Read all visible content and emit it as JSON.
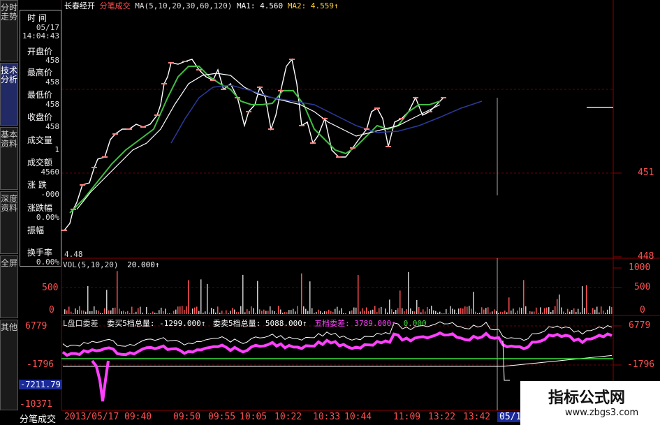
{
  "tabs": [
    {
      "label": "分时走势"
    },
    {
      "label": "技术分析"
    },
    {
      "label": "基本资料"
    },
    {
      "label": "深度资料"
    },
    {
      "label": "全屏"
    },
    {
      "label": "其他"
    }
  ],
  "info_panel": {
    "time_label": "时 间",
    "date": "05/17",
    "time": "14:04:43",
    "fields": [
      {
        "label": "开盘价",
        "value": "458"
      },
      {
        "label": "最高价",
        "value": "458"
      },
      {
        "label": "最低价",
        "value": "458"
      },
      {
        "label": "收盘价",
        "value": "458"
      },
      {
        "label": "成交量",
        "value": "1"
      },
      {
        "label": "成交额",
        "value": "4560"
      },
      {
        "label": "涨 跌",
        "value": "-000"
      },
      {
        "label": "涨跌幅",
        "value": "0.00%"
      },
      {
        "label": "振幅",
        "value": ""
      },
      {
        "label": "换手率",
        "value": "0.00%"
      }
    ]
  },
  "title_bar": {
    "stock": "长春经开",
    "mode": "分笔成交",
    "ma_params": "MA(5,10,20,30,60,120)",
    "ma1": "MA1: 4.560",
    "ma2": "MA2: 4.559↑"
  },
  "price_axis": {
    "upper": "451",
    "lower": "448",
    "min_marker": "4.48"
  },
  "volume_panel": {
    "label": "VOL(5,10,20)",
    "value": "20.000↑",
    "axis": [
      "1000",
      "500",
      "0"
    ],
    "left_axis": [
      "500",
      "0"
    ]
  },
  "indicator_panel": {
    "label": "L盘口委差",
    "buy_total": "委买5档总量: -1299.000↑",
    "sell_total": "委卖5档总量: 5088.000↑",
    "diff": "五档委差: 3789.000↑",
    "diff_ma": "0.000",
    "axis": [
      "6779",
      "-1796"
    ],
    "left_axis": [
      "6779",
      "-1796",
      "-7211.79",
      "-10371"
    ]
  },
  "time_axis": {
    "left_label": "分笔成交",
    "labels": [
      "2013/05/17",
      "09:40",
      "09:50",
      "09:55",
      "10:05",
      "10:22",
      "10:33",
      "10:44",
      "11:09",
      "13:22",
      "13:42",
      "05/1"
    ]
  },
  "watermark": {
    "title": "指标公式网",
    "url": "www.zbgs3.com"
  },
  "colors": {
    "bg": "#000000",
    "grid": "#8b0000",
    "axis_text": "#ff5050",
    "ma_white": "#ffffff",
    "ma_green": "#3fbf3f",
    "ma_blue": "#2a3a9a",
    "magenta": "#ff40ff"
  }
}
